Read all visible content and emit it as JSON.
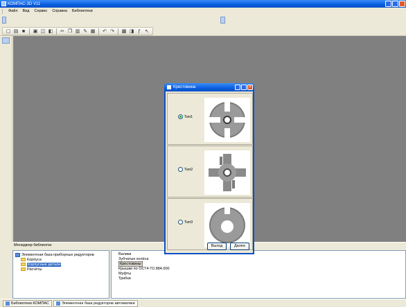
{
  "window": {
    "title": "КОМПАС-3D V11"
  },
  "menu": {
    "items": [
      "Файл",
      "Вид",
      "Сервис",
      "Справка",
      "Библиотеки"
    ]
  },
  "manager": {
    "title": "Менеджер библиотек",
    "tree": {
      "root": "Элементная база приборных редукторов",
      "children": [
        "Корпуса",
        "Корпусные детали",
        "Расчёты"
      ],
      "selected_index": 1
    },
    "list": {
      "items": [
        "Валики",
        "Зубчатые колёса",
        "Крестовины",
        "Крышки по ОСТ4 ГО.884.000",
        "Муфты",
        "Трибки"
      ],
      "selected_index": 2
    }
  },
  "status_tabs": [
    "Библиотеки КОМПАС",
    "Элементная база редукторов автоматики"
  ],
  "dialog": {
    "title": "Крестовина",
    "options": [
      {
        "label": "Тип1",
        "checked": true,
        "icon": "cross-type1-icon"
      },
      {
        "label": "Тип2",
        "checked": false,
        "icon": "cross-type2-icon"
      },
      {
        "label": "Тип3",
        "checked": false,
        "icon": "cross-type3-icon"
      }
    ],
    "back_label": "Выход",
    "next_label": "Далее"
  },
  "colors": {
    "workspace": "#808080",
    "titlebar": "#0a5ee0",
    "selection": "#316ac5"
  }
}
